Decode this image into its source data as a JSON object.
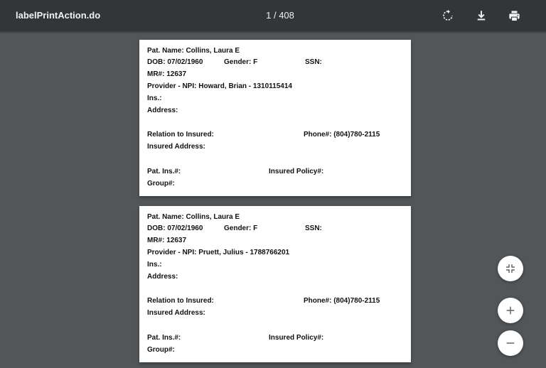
{
  "toolbar": {
    "title": "labelPrintAction.do",
    "page_current": "1",
    "page_separator": "/",
    "page_total": "408"
  },
  "pages": [
    {
      "pat_name": "Pat. Name: Collins, Laura E",
      "dob": "DOB: 07/02/1960",
      "gender": "Gender: F",
      "ssn": "SSN:",
      "mr": "MR#:  12637",
      "provider": "Provider - NPI: Howard, Brian - 1310115414",
      "ins": "Ins.:",
      "address": "Address:",
      "relation": "Relation to Insured:",
      "phone": "Phone#: (804)780-2115",
      "insured_address": "Insured Address:",
      "pat_ins": "Pat. Ins.#:",
      "insured_policy": "Insured Policy#:",
      "group": "Group#:"
    },
    {
      "pat_name": "Pat. Name: Collins, Laura E",
      "dob": "DOB: 07/02/1960",
      "gender": "Gender: F",
      "ssn": "SSN:",
      "mr": "MR#:  12637",
      "provider": "Provider - NPI: Pruett, Julius - 1788766201",
      "ins": "Ins.:",
      "address": "Address:",
      "relation": "Relation to Insured:",
      "phone": "Phone#: (804)780-2115",
      "insured_address": "Insured Address:",
      "pat_ins": "Pat. Ins.#:",
      "insured_policy": "Insured Policy#:",
      "group": "Group#:"
    }
  ],
  "icons": {
    "rotate": "rotate-icon",
    "download": "download-icon",
    "print": "print-icon",
    "fit": "fit-to-page-icon",
    "zoom_in": "zoom-in-icon",
    "zoom_out": "zoom-out-icon"
  },
  "colors": {
    "toolbar": "#323639",
    "background": "#525659",
    "page": "#ffffff"
  }
}
